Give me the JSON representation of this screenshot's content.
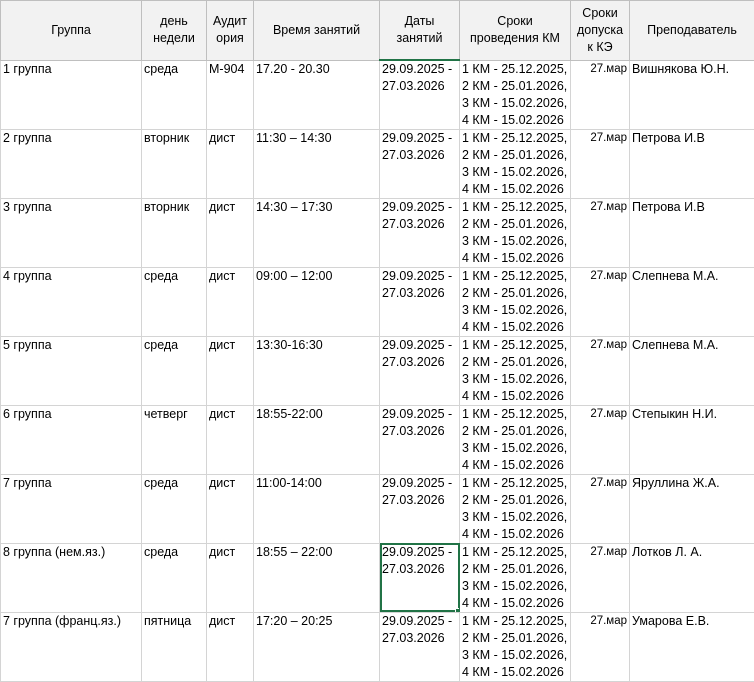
{
  "headers": [
    "Группа",
    "день недели",
    "Аудит ория",
    "Время занятий",
    "Даты занятий",
    "Сроки проведения КМ",
    "Сроки допуска к КЭ",
    "Преподаватель"
  ],
  "rows": [
    {
      "group": "1 группа",
      "day": "среда",
      "room": "М-904",
      "time": "17.20 - 20.30",
      "dates": [
        "29.09.2025 -",
        "27.03.2026"
      ],
      "km": [
        "1 КМ - 25.12.2025,",
        "2 КМ - 25.01.2026,",
        "3 КМ - 15.02.2026,",
        "4 КМ - 15.02.2026"
      ],
      "admit": "27.мар",
      "teacher": "Вишнякова Ю.Н."
    },
    {
      "group": "2 группа",
      "day": "вторник",
      "room": "дист",
      "time": "11:30 – 14:30",
      "dates": [
        "29.09.2025 -",
        "27.03.2026"
      ],
      "km": [
        "1 КМ - 25.12.2025,",
        "2 КМ - 25.01.2026,",
        "3 КМ - 15.02.2026,",
        "4 КМ - 15.02.2026"
      ],
      "admit": "27.мар",
      "teacher": "Петрова И.В"
    },
    {
      "group": "3 группа",
      "day": "вторник",
      "room": "дист",
      "time": "14:30 – 17:30",
      "dates": [
        "29.09.2025 -",
        "27.03.2026"
      ],
      "km": [
        "1 КМ - 25.12.2025,",
        "2 КМ - 25.01.2026,",
        "3 КМ - 15.02.2026,",
        "4 КМ - 15.02.2026"
      ],
      "admit": "27.мар",
      "teacher": "Петрова И.В"
    },
    {
      "group": "4 группа",
      "day": "среда",
      "room": "дист",
      "time": "09:00 – 12:00",
      "dates": [
        "29.09.2025 -",
        "27.03.2026"
      ],
      "km": [
        "1 КМ - 25.12.2025,",
        "2 КМ - 25.01.2026,",
        "3 КМ - 15.02.2026,",
        "4 КМ - 15.02.2026"
      ],
      "admit": "27.мар",
      "teacher": "Слепнева М.А."
    },
    {
      "group": "5 группа",
      "day": "среда",
      "room": "дист",
      "time": "13:30-16:30",
      "dates": [
        "29.09.2025 -",
        "27.03.2026"
      ],
      "km": [
        "1 КМ - 25.12.2025,",
        "2 КМ - 25.01.2026,",
        "3 КМ - 15.02.2026,",
        "4 КМ - 15.02.2026"
      ],
      "admit": "27.мар",
      "teacher": "Слепнева М.А."
    },
    {
      "group": "6 группа",
      "day": "четверг",
      "room": "дист",
      "time": "18:55-22:00",
      "dates": [
        "29.09.2025 -",
        "27.03.2026"
      ],
      "km": [
        "1 КМ - 25.12.2025,",
        "2 КМ - 25.01.2026,",
        "3 КМ - 15.02.2026,",
        "4 КМ - 15.02.2026"
      ],
      "admit": "27.мар",
      "teacher": "Степыкин Н.И."
    },
    {
      "group": "7 группа",
      "day": "среда",
      "room": "дист",
      "time": "11:00-14:00",
      "dates": [
        "29.09.2025 -",
        "27.03.2026"
      ],
      "km": [
        "1 КМ - 25.12.2025,",
        "2 КМ - 25.01.2026,",
        "3 КМ - 15.02.2026,",
        "4 КМ - 15.02.2026"
      ],
      "admit": "27.мар",
      "teacher": "Яруллина Ж.А."
    },
    {
      "group": "8 группа (нем.яз.)",
      "day": "среда",
      "room": "дист",
      "time": "18:55 – 22:00",
      "dates": [
        "29.09.2025 -",
        "27.03.2026"
      ],
      "km": [
        "1 КМ - 25.12.2025,",
        "2 КМ - 25.01.2026,",
        "3 КМ - 15.02.2026,",
        "4 КМ - 15.02.2026"
      ],
      "admit": "27.мар",
      "teacher": "Лотков Л. А."
    },
    {
      "group": "7 группа (франц.яз.)",
      "day": "пятница",
      "room": "дист",
      "time": "17:20 – 20:25",
      "dates": [
        "29.09.2025 -",
        "27.03.2026"
      ],
      "km": [
        "1 КМ - 25.12.2025,",
        "2 КМ - 25.01.2026,",
        "3 КМ - 15.02.2026,",
        "4 КМ - 15.02.2026"
      ],
      "admit": "27.мар",
      "teacher": "Умарова Е.В."
    }
  ],
  "colors": {
    "selection": "#217346",
    "header_bg": "#f2f2f2",
    "grid": "#d4d4d4"
  }
}
